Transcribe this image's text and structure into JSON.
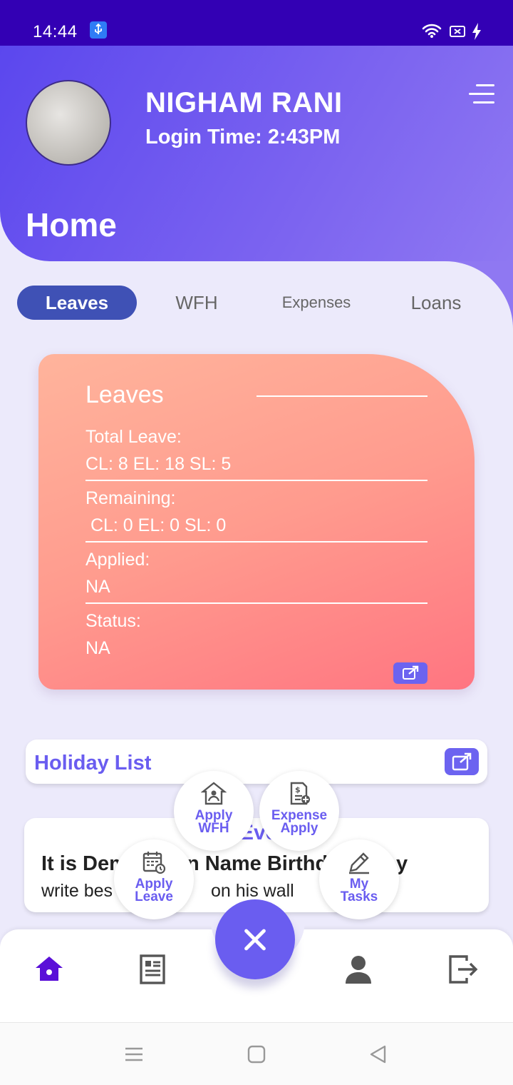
{
  "status_bar": {
    "time": "14:44"
  },
  "header": {
    "user_name": "NIGHAM RANI",
    "login_time": "Login Time: 2:43PM",
    "page_title": "Home"
  },
  "tabs": [
    {
      "label": "Leaves",
      "active": true
    },
    {
      "label": "WFH",
      "active": false
    },
    {
      "label": "Expenses",
      "active": false
    },
    {
      "label": "Loans",
      "active": false
    }
  ],
  "leave_card": {
    "title": "Leaves",
    "total_label": "Total Leave:",
    "total_value": "CL: 8 EL: 18 SL: 5",
    "remaining_label": "Remaining:",
    "remaining_value": " CL: 0 EL: 0 SL: 0",
    "applied_label": "Applied:",
    "applied_value": "NA",
    "status_label": "Status:",
    "status_value": "NA"
  },
  "holiday_list": {
    "title": "Holiday List"
  },
  "events": {
    "title": "Eve",
    "headline_left": "It is Dem",
    "headline_right": "n Name Birthd",
    "headline_tail": "y",
    "sub_left": "write bes",
    "sub_right": "on his wall"
  },
  "fab_menu": {
    "apply_wfh": "Apply WFH",
    "expense_apply": "Expense Apply",
    "apply_leave": "Apply Leave",
    "my_tasks": "My Tasks"
  },
  "colors": {
    "accent": "#6a5df0",
    "header_start": "#5b47ee",
    "header_end": "#8f78f2",
    "tab_active": "#3f51b5",
    "card_start": "#ffb49c",
    "card_end": "#ff7581",
    "nav_active": "#5a10d8"
  },
  "icons": {
    "bottom_nav": [
      "home-icon",
      "document-icon",
      "close-icon",
      "person-icon",
      "logout-icon"
    ],
    "fab_menu": [
      "home-person-icon",
      "receipt-add-icon",
      "calendar-clock-icon",
      "pencil-icon"
    ]
  }
}
